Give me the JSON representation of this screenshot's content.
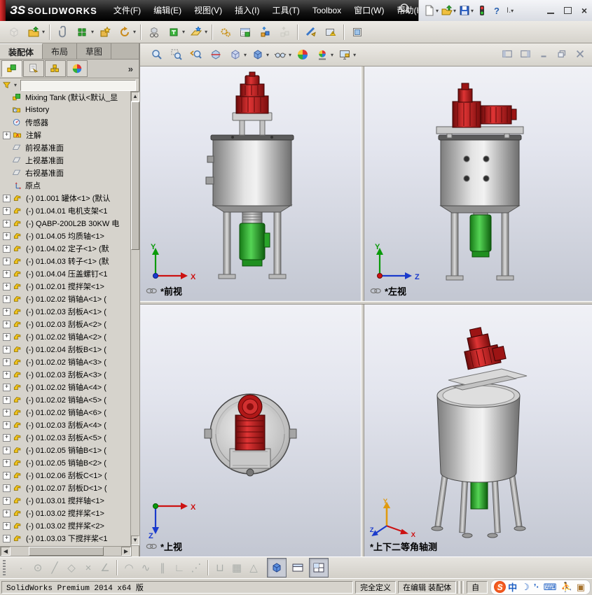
{
  "titlebar": {
    "logo_mark": "ЗS",
    "logo_text": "SOLIDWORKS",
    "menus": [
      "文件(F)",
      "编辑(E)",
      "视图(V)",
      "插入(I)",
      "工具(T)",
      "Toolbox",
      "窗口(W)",
      "帮助(H)"
    ],
    "indicator": "I.",
    "quick_access": [
      {
        "name": "new-document",
        "icon": "new-doc",
        "dropdown": true
      },
      {
        "name": "open-document",
        "icon": "open-doc",
        "dropdown": true
      },
      {
        "name": "save-document",
        "icon": "save",
        "dropdown": true
      },
      {
        "name": "rebuild-traffic-light",
        "icon": "traffic",
        "dropdown": false
      },
      {
        "name": "help",
        "icon": "help",
        "dropdown": true
      }
    ]
  },
  "toolbar2": {
    "buttons": [
      {
        "name": "insert-component",
        "icon": "ghost-cube",
        "disabled": true
      },
      {
        "name": "open-part",
        "icon": "open-green",
        "dropdown": true
      },
      {
        "sep": true
      },
      {
        "name": "mate",
        "icon": "paperclip"
      },
      {
        "name": "linear-component-pattern",
        "icon": "pattern-green",
        "dropdown": true
      },
      {
        "name": "smart-fasteners",
        "icon": "fastener"
      },
      {
        "name": "move-component",
        "icon": "rotate-gold",
        "dropdown": true
      },
      {
        "sep": true
      },
      {
        "name": "show-hidden-components",
        "icon": "cube-glasses"
      },
      {
        "name": "assembly-features",
        "icon": "feature-green",
        "dropdown": true
      },
      {
        "name": "reference-geometry",
        "icon": "ref-plane",
        "dropdown": true
      },
      {
        "sep": true
      },
      {
        "name": "new-motion-study",
        "icon": "gears-gold"
      },
      {
        "name": "bill-of-materials",
        "icon": "bom-window"
      },
      {
        "name": "exploded-view",
        "icon": "explode"
      },
      {
        "name": "explode-line-sketch",
        "icon": "explode-ghost",
        "disabled": true
      },
      {
        "sep": true
      },
      {
        "name": "interference-detection",
        "icon": "interfere"
      },
      {
        "name": "simulation-advisor",
        "icon": "sim-alert"
      },
      {
        "sep": true
      },
      {
        "name": "preview-window",
        "icon": "preview"
      }
    ]
  },
  "left_panel": {
    "tabs": [
      "装配体",
      "布局",
      "草图"
    ],
    "active_tab": 0,
    "more_chevron": "»",
    "manager_tabs": [
      {
        "name": "feature-manager",
        "icon": "fm-tab"
      },
      {
        "name": "property-manager",
        "icon": "pm-tab"
      },
      {
        "name": "configuration-manager",
        "icon": "cm-tab"
      },
      {
        "name": "display-manager",
        "icon": "dm-tab"
      }
    ],
    "tree": {
      "items": [
        {
          "icon": "assembly-root",
          "text": "Mixing Tank (默认<默认_显",
          "root": true
        },
        {
          "icon": "history",
          "text": "History"
        },
        {
          "icon": "sensors",
          "text": "传感器"
        },
        {
          "icon": "annotations",
          "text": "注解",
          "plus": true
        },
        {
          "icon": "plane",
          "text": "前视基准面"
        },
        {
          "icon": "plane",
          "text": "上视基准面"
        },
        {
          "icon": "plane",
          "text": "右视基准面"
        },
        {
          "icon": "origin",
          "text": "原点"
        },
        {
          "icon": "part",
          "text": "(-) 01.001 罐体<1> (默认",
          "plus": true
        },
        {
          "icon": "part",
          "text": "(-) 01.04.01 电机支架<1",
          "plus": true
        },
        {
          "icon": "part",
          "text": "(-) QABP-200L2B 30KW 电",
          "plus": true
        },
        {
          "icon": "part",
          "text": "(-) 01.04.05 均质轴<1>",
          "plus": true
        },
        {
          "icon": "part",
          "text": "(-) 01.04.02 定子<1> (默",
          "plus": true
        },
        {
          "icon": "part",
          "text": "(-) 01.04.03 转子<1> (默",
          "plus": true
        },
        {
          "icon": "part",
          "text": "(-) 01.04.04 压盖螺钉<1",
          "plus": true
        },
        {
          "icon": "part",
          "text": "(-) 01.02.01 搅拌架<1>",
          "plus": true
        },
        {
          "icon": "part",
          "text": "(-) 01.02.02 销轴A<1> (",
          "plus": true
        },
        {
          "icon": "part",
          "text": "(-) 01.02.03 刮板A<1> (",
          "plus": true
        },
        {
          "icon": "part",
          "text": "(-) 01.02.03 刮板A<2> (",
          "plus": true
        },
        {
          "icon": "part",
          "text": "(-) 01.02.02 销轴A<2> (",
          "plus": true
        },
        {
          "icon": "part",
          "text": "(-) 01.02.04 刮板B<1> (",
          "plus": true
        },
        {
          "icon": "part",
          "text": "(-) 01.02.02 销轴A<3> (",
          "plus": true
        },
        {
          "icon": "part",
          "text": "(-) 01.02.03 刮板A<3> (",
          "plus": true
        },
        {
          "icon": "part",
          "text": "(-) 01.02.02 销轴A<4> (",
          "plus": true
        },
        {
          "icon": "part",
          "text": "(-) 01.02.02 销轴A<5> (",
          "plus": true
        },
        {
          "icon": "part",
          "text": "(-) 01.02.02 销轴A<6> (",
          "plus": true
        },
        {
          "icon": "part",
          "text": "(-) 01.02.03 刮板A<4> (",
          "plus": true
        },
        {
          "icon": "part",
          "text": "(-) 01.02.03 刮板A<5> (",
          "plus": true
        },
        {
          "icon": "part",
          "text": "(-) 01.02.05 销轴B<1> (",
          "plus": true
        },
        {
          "icon": "part",
          "text": "(-) 01.02.05 销轴B<2> (",
          "plus": true
        },
        {
          "icon": "part",
          "text": "(-) 01.02.06 刮板C<1> (",
          "plus": true
        },
        {
          "icon": "part",
          "text": "(-) 01.02.07 刮板D<1> (",
          "plus": true
        },
        {
          "icon": "part",
          "text": "(-) 01.03.01 搅拌轴<1>",
          "plus": true
        },
        {
          "icon": "part",
          "text": "(-) 01.03.02 搅拌桨<1>",
          "plus": true
        },
        {
          "icon": "part",
          "text": "(-) 01.03.02 搅拌桨<2>",
          "plus": true
        },
        {
          "icon": "part",
          "text": "(-) 01.03.03 下搅拌桨<1",
          "plus": true
        }
      ]
    }
  },
  "headsup": {
    "buttons": [
      {
        "name": "zoom-to-fit",
        "icon": "zoom-fit"
      },
      {
        "name": "zoom-to-area",
        "icon": "zoom-area"
      },
      {
        "name": "previous-view",
        "icon": "view-prev"
      },
      {
        "name": "section-view",
        "icon": "section"
      },
      {
        "name": "view-orientation",
        "icon": "cube-orient",
        "dropdown": true
      },
      {
        "name": "display-style",
        "icon": "cube-style",
        "dropdown": true
      },
      {
        "name": "hide-show-items",
        "icon": "glasses",
        "dropdown": true
      },
      {
        "name": "edit-appearance",
        "icon": "color-ball"
      },
      {
        "name": "apply-scene",
        "icon": "scene-ball",
        "dropdown": true
      },
      {
        "name": "view-settings",
        "icon": "monitor",
        "dropdown": true
      }
    ],
    "doc_controls": [
      {
        "name": "pane-left",
        "icon": "pane-left"
      },
      {
        "name": "pane-right",
        "icon": "pane-right"
      },
      {
        "name": "doc-minimize",
        "icon": "min"
      },
      {
        "name": "doc-restore",
        "icon": "restore"
      },
      {
        "name": "doc-close",
        "icon": "close"
      }
    ]
  },
  "viewports": [
    {
      "label": "*前视",
      "axes": {
        "a0": "Y",
        "a1": "X"
      },
      "linked": true
    },
    {
      "label": "*左视",
      "axes": {
        "a0": "Y",
        "a1": "Z"
      },
      "linked": true
    },
    {
      "label": "*上视",
      "axes": {
        "a0": "X",
        "a1": "Z"
      },
      "linked": true
    },
    {
      "label": "*上下二等角轴测",
      "axes": {
        "a0": "Y",
        "a1": "X",
        "a2": "Z"
      },
      "linked": false
    }
  ],
  "bottom_toolbar": {
    "snaps": [
      "point",
      "center-circle",
      "line",
      "polygon",
      "cross",
      "corner-angle",
      "divider",
      "arc",
      "spline",
      "parallel",
      "perpendicular",
      "dotted-trail",
      "divider",
      "dimension",
      "grid",
      "angle-snap"
    ],
    "view_buttons": [
      {
        "name": "single-view",
        "icon": "single-view",
        "active": true
      },
      {
        "name": "two-view",
        "icon": "two-view",
        "active": false
      },
      {
        "name": "four-view",
        "icon": "four-view",
        "active": true
      }
    ]
  },
  "status": {
    "left": "SolidWorks Premium 2014 x64 版",
    "defined": "完全定义",
    "editing": "在编辑 装配体",
    "custom_partial": "自",
    "ime": {
      "sogou": "S",
      "lang": "中",
      "items": [
        "moon",
        "punct",
        "keyboard",
        "person",
        "toolbox"
      ]
    }
  },
  "colors": {
    "brand_red": "#d11f2f",
    "tank_grey": "#b5b5b5",
    "motor_red": "#b01212",
    "motor_green": "#2db82d",
    "viewport_gradient_top": "#f0f1f6",
    "viewport_gradient_bottom": "#c3c7d2"
  }
}
